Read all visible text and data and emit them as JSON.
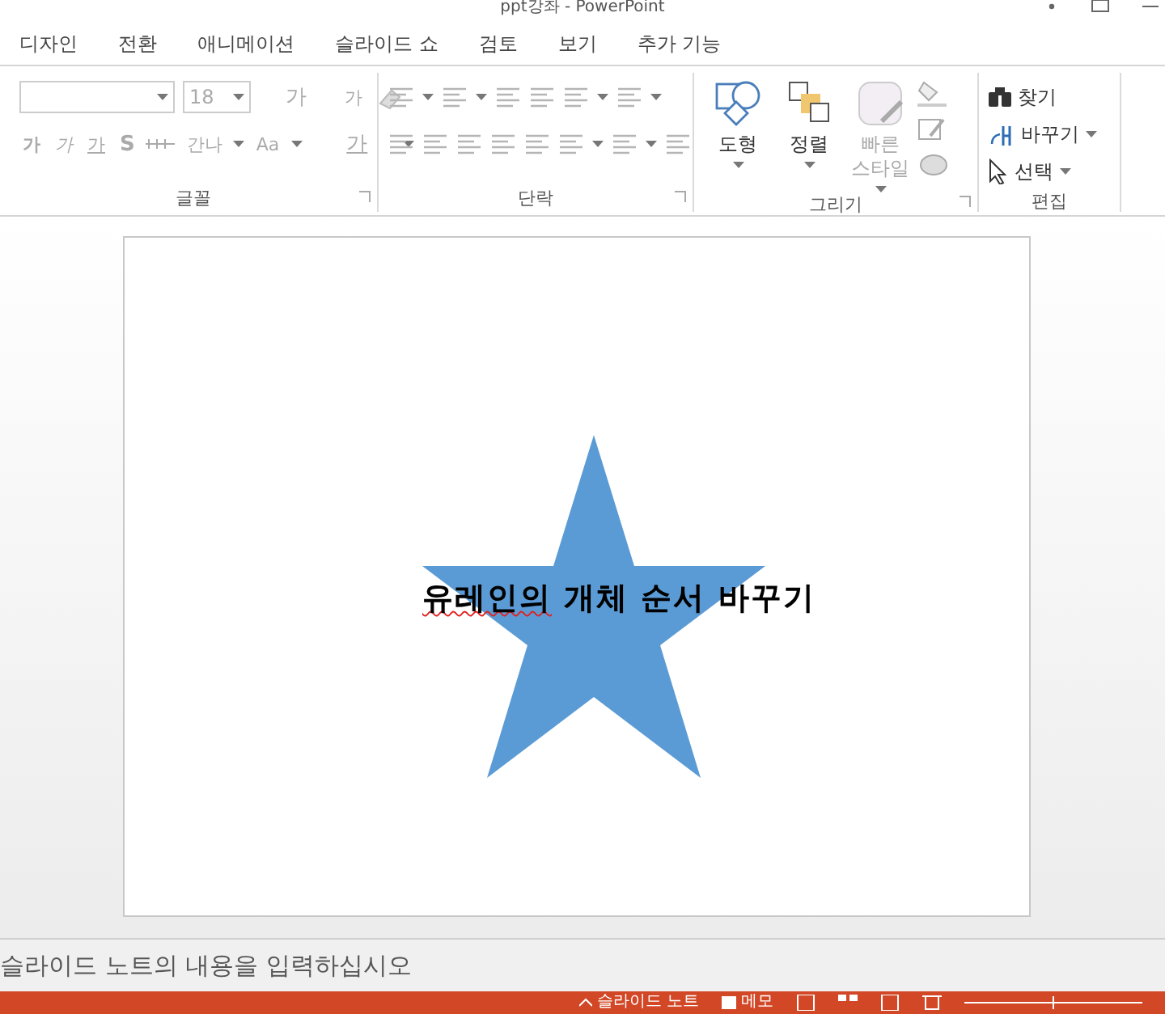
{
  "window": {
    "title": "ppt강좌 - PowerPoint"
  },
  "tabs": [
    {
      "label": "디자인",
      "selected": false
    },
    {
      "label": "전환",
      "selected": false
    },
    {
      "label": "애니메이션",
      "selected": false
    },
    {
      "label": "슬라이드 쇼",
      "selected": false
    },
    {
      "label": "검토",
      "selected": false
    },
    {
      "label": "보기",
      "selected": false
    },
    {
      "label": "추가 기능",
      "selected": false
    }
  ],
  "ribbon": {
    "font": {
      "label": "글꼴",
      "font_size": "18",
      "disabled": true,
      "grow": "가",
      "shrink": "가",
      "bold": "가",
      "italic": "가",
      "underline": "가",
      "shadow": "S",
      "spacing": "간나",
      "case": "Aa",
      "color_button": "가"
    },
    "paragraph": {
      "label": "단락",
      "disabled": true
    },
    "drawing": {
      "label": "그리기",
      "buttons": [
        {
          "kind": "shape",
          "label": "도형",
          "disabled": false
        },
        {
          "kind": "arrange",
          "label": "정렬",
          "disabled": false
        },
        {
          "kind": "style",
          "label": "빠른 스타일",
          "disabled": true
        }
      ]
    },
    "editing": {
      "label": "편집",
      "items": [
        {
          "kind": "find",
          "label": "찾기"
        },
        {
          "kind": "replace",
          "label": "바꾸기"
        },
        {
          "kind": "select",
          "label": "선택"
        }
      ]
    }
  },
  "slide": {
    "runs": [
      {
        "text": "유레인의",
        "misspelled": true
      },
      {
        "text": " 개체 순서 바꾸기",
        "misspelled": false
      }
    ]
  },
  "notes": {
    "placeholder": "슬라이드 노트의 내용을 입력하십시오"
  },
  "status_bar": {
    "notes_button": "슬라이드 노트",
    "comments_button": "메모"
  }
}
